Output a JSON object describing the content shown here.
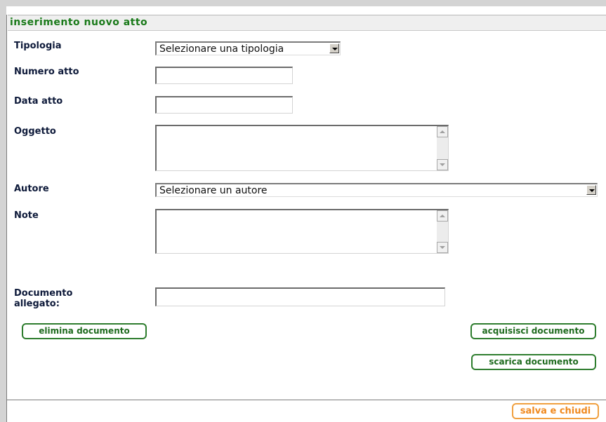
{
  "form": {
    "title": "inserimento nuovo atto",
    "fields": {
      "tipologia_label": "Tipologia",
      "tipologia_value": "Selezionare una tipologia",
      "numero_label": "Numero atto",
      "numero_value": "",
      "data_label": "Data atto",
      "data_value": "",
      "oggetto_label": "Oggetto",
      "oggetto_value": "",
      "autore_label": "Autore",
      "autore_value": "Selezionare un autore",
      "note_label": "Note",
      "note_value": "",
      "documento_label_line1": "Documento",
      "documento_label_line2": "allegato:",
      "documento_value": ""
    },
    "buttons": {
      "elimina": "elimina documento",
      "acquisisci": "acquisisci documento",
      "scarica": "scarica documento",
      "salva": "salva e chiudi"
    }
  },
  "colors": {
    "title_green": "#1a7a1a",
    "button_green": "#2e7d2e",
    "save_orange": "#f08a20"
  }
}
